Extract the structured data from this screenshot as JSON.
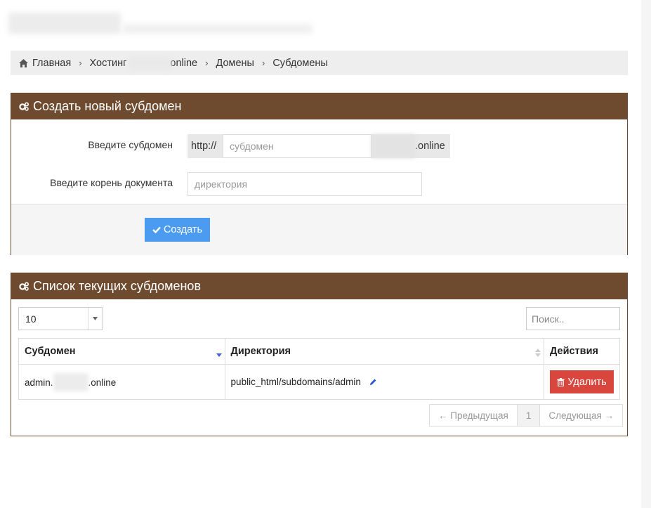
{
  "breadcrumb": {
    "home": "Главная",
    "hosting_prefix": "Хостинг",
    "hosting_suffix": "online",
    "domains": "Домены",
    "subdomains": "Субдомены"
  },
  "create_panel": {
    "title": "Создать новый субдомен",
    "subdomain_label": "Введите субдомен",
    "protocol_addon": "http://",
    "subdomain_placeholder": "субдомен",
    "domain_suffix": ".online",
    "docroot_label": "Введите корень документа",
    "docroot_placeholder": "директория",
    "create_button": "Создать"
  },
  "list_panel": {
    "title": "Список текущих субдоменов",
    "page_size": "10",
    "search_placeholder": "Поиск..",
    "columns": [
      "Субдомен",
      "Директория",
      "Действия"
    ],
    "rows": [
      {
        "subdomain_prefix": "admin.",
        "subdomain_suffix": ".online",
        "directory": "public_html/subdomains/admin",
        "action": "Удалить"
      }
    ],
    "pager": {
      "prev": "← Предыдущая",
      "page": "1",
      "next": "Следующая →"
    }
  },
  "colors": {
    "panel_header": "#6e4a2e",
    "primary": "#4b9cf0",
    "danger": "#d9463e"
  }
}
